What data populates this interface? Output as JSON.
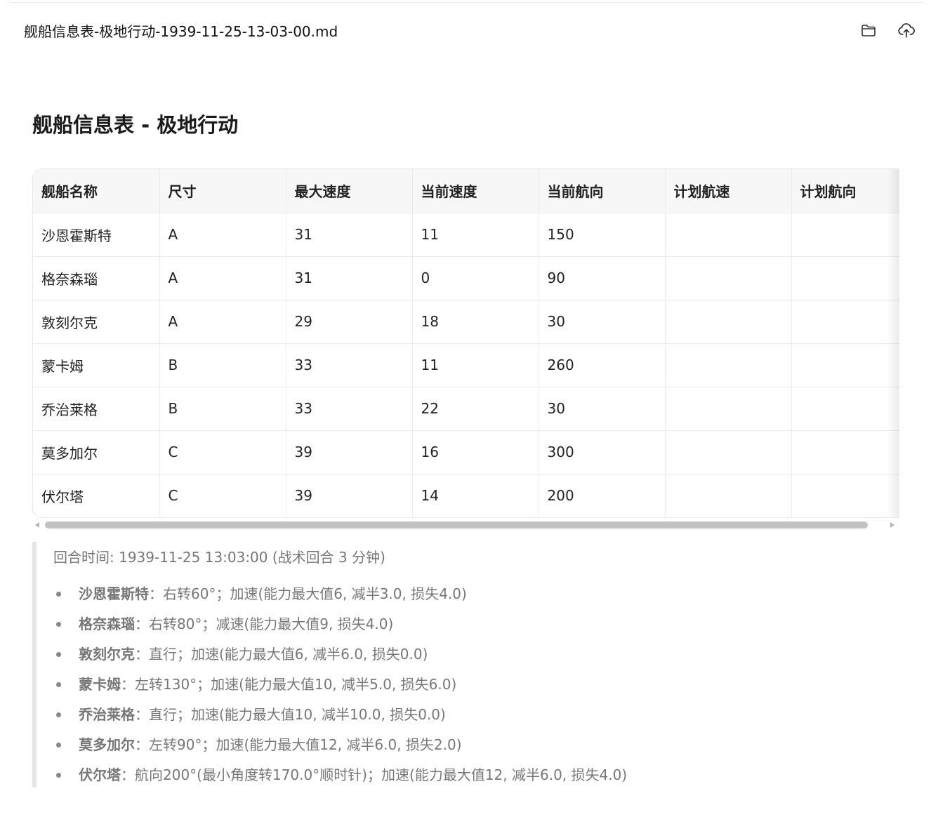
{
  "header": {
    "filename": "舰船信息表-极地行动-1939-11-25-13-03-00.md",
    "folder_icon": "folder-icon",
    "upload_icon": "cloud-upload-icon"
  },
  "doc": {
    "title": "舰船信息表 - 极地行动"
  },
  "table": {
    "headers": [
      "舰船名称",
      "尺寸",
      "最大速度",
      "当前速度",
      "当前航向",
      "计划航速",
      "计划航向"
    ],
    "rows": [
      [
        "沙恩霍斯特",
        "A",
        "31",
        "11",
        "150",
        "",
        ""
      ],
      [
        "格奈森瑙",
        "A",
        "31",
        "0",
        "90",
        "",
        ""
      ],
      [
        "敦刻尔克",
        "A",
        "29",
        "18",
        "30",
        "",
        ""
      ],
      [
        "蒙卡姆",
        "B",
        "33",
        "11",
        "260",
        "",
        ""
      ],
      [
        "乔治莱格",
        "B",
        "33",
        "22",
        "30",
        "",
        ""
      ],
      [
        "莫多加尔",
        "C",
        "39",
        "16",
        "300",
        "",
        ""
      ],
      [
        "伏尔塔",
        "C",
        "39",
        "14",
        "200",
        "",
        ""
      ]
    ]
  },
  "notes": {
    "round_time": "回合时间: 1939-11-25 13:03:00 (战术回合 3 分钟)",
    "orders": [
      {
        "ship": "沙恩霍斯特",
        "sep": "：",
        "text": "右转60°；加速(能力最大值6, 减半3.0, 损失4.0)"
      },
      {
        "ship": "格奈森瑙",
        "sep": "：",
        "text": "右转80°；减速(能力最大值9, 损失4.0)"
      },
      {
        "ship": "敦刻尔克",
        "sep": "：",
        "text": "直行；加速(能力最大值6, 减半6.0, 损失0.0)"
      },
      {
        "ship": "蒙卡姆",
        "sep": "：",
        "text": "左转130°；加速(能力最大值10, 减半5.0, 损失6.0)"
      },
      {
        "ship": "乔治莱格",
        "sep": "：",
        "text": "直行；加速(能力最大值10, 减半10.0, 损失0.0)"
      },
      {
        "ship": "莫多加尔",
        "sep": "：",
        "text": "左转90°；加速(能力最大值12, 减半6.0, 损失2.0)"
      },
      {
        "ship": "伏尔塔",
        "sep": "：",
        "text": "航向200°(最小角度转170.0°顺时针)；加速(能力最大值12, 减半6.0, 损失4.0)"
      }
    ]
  }
}
